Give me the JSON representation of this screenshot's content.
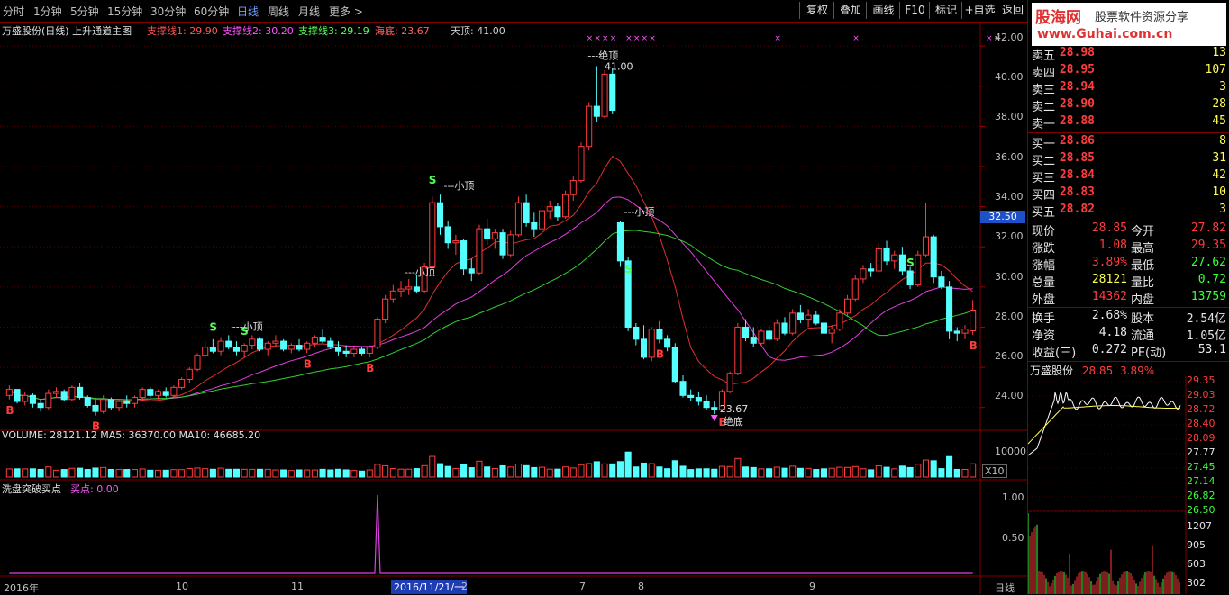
{
  "periods": [
    "分时",
    "1分钟",
    "5分钟",
    "15分钟",
    "30分钟",
    "60分钟",
    "日线",
    "周线",
    "月线",
    "更多 >"
  ],
  "active_period": "日线",
  "toolbar": [
    "复权",
    "叠加",
    "画线",
    "F10",
    "标记",
    "+自选",
    "返回"
  ],
  "logo": {
    "main": "股海网",
    "sub": "股票软件资源分享",
    "url": "www.Guhai.com.cn"
  },
  "main_title": "万盛股份(日线) 上升通道主图",
  "indicators": [
    {
      "label": "支撑线1: 29.90",
      "color": "#ff5555"
    },
    {
      "label": "支撑线2: 30.20",
      "color": "#ff55ff"
    },
    {
      "label": "支撑线3: 29.19",
      "color": "#55ff55"
    },
    {
      "label": "海底: 23.67",
      "color": "#ff6060"
    },
    {
      "label": "天顶: 41.00",
      "color": "#d0d0d0"
    }
  ],
  "price_axis": [
    "42.00",
    "40.00",
    "38.00",
    "36.00",
    "34.00",
    "32.00",
    "30.00",
    "28.00",
    "26.00",
    "24.00"
  ],
  "price_marker": "32.50",
  "volume_title": "VOLUME: 28121.12  MA5: 36370.00  MA10: 46685.20",
  "volume_axis": [
    "10000"
  ],
  "volume_unit": "X10",
  "sub_title": "洗盘突破买点",
  "sub_value": "买点: 0.00",
  "sub_axis": [
    "1.00",
    "0.50"
  ],
  "dates": [
    "2016年",
    "10",
    "11",
    "2016/11/21/一",
    "2",
    "7",
    "8",
    "9"
  ],
  "date_mode": "日线",
  "annotations": {
    "top": "---绝顶",
    "top_price": "41.00",
    "small_top": "---小顶",
    "bottom": "23.67",
    "bottom_label": "绝底",
    "S": "S",
    "B": "B"
  },
  "order_book": [
    {
      "label": "卖五",
      "price": "28.98",
      "vol": "13"
    },
    {
      "label": "卖四",
      "price": "28.95",
      "vol": "107"
    },
    {
      "label": "卖三",
      "price": "28.94",
      "vol": "3"
    },
    {
      "label": "卖二",
      "price": "28.90",
      "vol": "28"
    },
    {
      "label": "卖一",
      "price": "28.88",
      "vol": "45"
    },
    {
      "label": "买一",
      "price": "28.86",
      "vol": "8"
    },
    {
      "label": "买二",
      "price": "28.85",
      "vol": "31"
    },
    {
      "label": "买三",
      "price": "28.84",
      "vol": "42"
    },
    {
      "label": "买四",
      "price": "28.83",
      "vol": "10"
    },
    {
      "label": "买五",
      "price": "28.82",
      "vol": "3"
    }
  ],
  "quote": [
    {
      "k1": "现价",
      "v1": "28.85",
      "c1": "#ff3c3c",
      "k2": "今开",
      "v2": "27.82",
      "c2": "#ff3c3c"
    },
    {
      "k1": "涨跌",
      "v1": "1.08",
      "c1": "#ff3c3c",
      "k2": "最高",
      "v2": "29.35",
      "c2": "#ff3c3c"
    },
    {
      "k1": "涨幅",
      "v1": "3.89%",
      "c1": "#ff3c3c",
      "k2": "最低",
      "v2": "27.62",
      "c2": "#3cff3c"
    },
    {
      "k1": "总量",
      "v1": "28121",
      "c1": "#ffff54",
      "k2": "量比",
      "v2": "0.72",
      "c2": "#3cff3c"
    },
    {
      "k1": "外盘",
      "v1": "14362",
      "c1": "#ff3c3c",
      "k2": "内盘",
      "v2": "13759",
      "c2": "#3cff3c"
    },
    {
      "k1": "换手",
      "v1": "2.68%",
      "c1": "#e6e6e6",
      "k2": "股本",
      "v2": "2.54亿",
      "c2": "#e6e6e6"
    },
    {
      "k1": "净资",
      "v1": "4.18",
      "c1": "#e6e6e6",
      "k2": "流通",
      "v2": "1.05亿",
      "c2": "#e6e6e6"
    },
    {
      "k1": "收益(三)",
      "v1": "0.272",
      "c1": "#e6e6e6",
      "k2": "PE(动)",
      "v2": "53.1",
      "c2": "#e6e6e6"
    }
  ],
  "mini": {
    "name": "万盛股份",
    "price": "28.85",
    "pct": "3.89%",
    "price_axis": [
      "29.35",
      "29.03",
      "28.72",
      "28.40",
      "28.09",
      "27.77",
      "27.45",
      "27.14",
      "26.82",
      "26.50"
    ],
    "vol_axis": [
      "1207",
      "905",
      "603",
      "302"
    ]
  },
  "chart_data": {
    "type": "candlestick",
    "title": "万盛股份(日线) 上升通道主图",
    "ylim": [
      23,
      42.5
    ],
    "candles": [
      [
        24.6,
        25.1,
        24.4,
        24.9
      ],
      [
        24.9,
        24.9,
        24.2,
        24.3
      ],
      [
        24.3,
        24.8,
        24.1,
        24.6
      ],
      [
        24.6,
        24.7,
        24.0,
        24.2
      ],
      [
        24.2,
        24.4,
        23.8,
        24.0
      ],
      [
        24.0,
        24.9,
        23.9,
        24.7
      ],
      [
        24.7,
        25.0,
        24.5,
        24.8
      ],
      [
        24.8,
        24.9,
        24.3,
        24.4
      ],
      [
        24.4,
        25.1,
        24.3,
        25.0
      ],
      [
        25.0,
        25.2,
        24.4,
        24.5
      ],
      [
        24.5,
        24.6,
        24.0,
        24.1
      ],
      [
        24.1,
        24.4,
        23.6,
        23.8
      ],
      [
        23.8,
        24.6,
        23.7,
        24.4
      ],
      [
        24.4,
        24.5,
        23.9,
        24.0
      ],
      [
        24.0,
        24.4,
        23.8,
        24.3
      ],
      [
        24.3,
        24.6,
        24.0,
        24.2
      ],
      [
        24.2,
        24.6,
        24.0,
        24.5
      ],
      [
        24.5,
        25.0,
        24.3,
        24.9
      ],
      [
        24.9,
        25.0,
        24.5,
        24.6
      ],
      [
        24.6,
        24.9,
        24.4,
        24.8
      ],
      [
        24.8,
        25.0,
        24.5,
        24.6
      ],
      [
        24.6,
        25.1,
        24.5,
        25.0
      ],
      [
        25.0,
        25.5,
        24.9,
        25.4
      ],
      [
        25.4,
        26.0,
        25.2,
        25.9
      ],
      [
        25.9,
        26.7,
        25.8,
        26.6
      ],
      [
        26.6,
        27.3,
        26.5,
        27.0
      ],
      [
        27.0,
        27.4,
        26.7,
        26.8
      ],
      [
        26.8,
        27.5,
        26.6,
        27.3
      ],
      [
        27.3,
        27.6,
        26.9,
        27.0
      ],
      [
        27.0,
        27.3,
        26.6,
        26.8
      ],
      [
        26.8,
        27.2,
        26.5,
        27.1
      ],
      [
        27.1,
        27.6,
        26.9,
        27.4
      ],
      [
        27.4,
        27.5,
        26.8,
        26.9
      ],
      [
        26.9,
        27.3,
        26.6,
        27.2
      ],
      [
        27.2,
        27.6,
        27.0,
        27.3
      ],
      [
        27.3,
        27.4,
        26.8,
        26.9
      ],
      [
        26.9,
        27.2,
        26.7,
        27.1
      ],
      [
        27.1,
        27.4,
        26.8,
        26.9
      ],
      [
        26.9,
        27.3,
        26.7,
        27.2
      ],
      [
        27.2,
        27.6,
        27.0,
        27.5
      ],
      [
        27.5,
        27.9,
        27.2,
        27.3
      ],
      [
        27.3,
        27.5,
        26.9,
        27.0
      ],
      [
        27.0,
        27.3,
        26.6,
        26.8
      ],
      [
        26.8,
        27.1,
        26.5,
        26.7
      ],
      [
        26.7,
        27.0,
        26.5,
        26.9
      ],
      [
        26.9,
        27.0,
        26.6,
        26.7
      ],
      [
        26.7,
        27.1,
        26.5,
        27.0
      ],
      [
        27.0,
        28.5,
        26.9,
        28.4
      ],
      [
        28.4,
        29.6,
        28.2,
        29.4
      ],
      [
        29.4,
        30.1,
        29.2,
        29.8
      ],
      [
        29.8,
        30.3,
        29.5,
        29.9
      ],
      [
        29.9,
        30.4,
        29.6,
        30.0
      ],
      [
        30.0,
        30.6,
        29.7,
        29.8
      ],
      [
        29.8,
        31.2,
        29.7,
        31.0
      ],
      [
        31.0,
        34.5,
        30.9,
        34.2
      ],
      [
        34.2,
        34.6,
        32.6,
        33.0
      ],
      [
        33.0,
        33.3,
        31.9,
        32.2
      ],
      [
        32.2,
        32.6,
        31.6,
        32.3
      ],
      [
        32.3,
        32.4,
        30.6,
        30.9
      ],
      [
        30.9,
        31.4,
        30.3,
        30.7
      ],
      [
        30.7,
        33.1,
        30.6,
        32.9
      ],
      [
        32.9,
        33.4,
        32.1,
        32.4
      ],
      [
        32.4,
        32.9,
        31.9,
        32.7
      ],
      [
        32.7,
        32.9,
        31.4,
        31.6
      ],
      [
        31.6,
        32.8,
        31.5,
        32.6
      ],
      [
        32.6,
        34.5,
        32.5,
        34.2
      ],
      [
        34.2,
        34.6,
        33.0,
        33.2
      ],
      [
        33.2,
        33.7,
        32.5,
        32.9
      ],
      [
        32.9,
        34.0,
        32.7,
        33.8
      ],
      [
        33.8,
        34.3,
        33.4,
        34.0
      ],
      [
        34.0,
        34.2,
        33.3,
        33.5
      ],
      [
        33.5,
        34.8,
        33.4,
        34.6
      ],
      [
        34.6,
        35.5,
        34.3,
        35.3
      ],
      [
        35.3,
        37.2,
        35.2,
        37.0
      ],
      [
        37.0,
        39.2,
        36.8,
        39.0
      ],
      [
        39.0,
        41.0,
        38.2,
        38.5
      ],
      [
        38.5,
        40.8,
        38.4,
        40.6
      ],
      [
        40.6,
        40.9,
        38.6,
        38.8
      ],
      [
        33.2,
        33.3,
        31.0,
        31.3
      ],
      [
        31.3,
        31.5,
        27.8,
        28.0
      ],
      [
        28.0,
        28.2,
        27.1,
        27.4
      ],
      [
        27.4,
        28.1,
        26.4,
        26.5
      ],
      [
        26.5,
        28.0,
        26.3,
        27.9
      ],
      [
        27.9,
        28.3,
        27.2,
        27.4
      ],
      [
        27.4,
        27.6,
        26.8,
        27.0
      ],
      [
        27.0,
        27.2,
        25.2,
        25.3
      ],
      [
        25.3,
        25.6,
        24.5,
        24.6
      ],
      [
        24.6,
        24.9,
        24.3,
        24.5
      ],
      [
        24.5,
        24.8,
        24.1,
        24.3
      ],
      [
        24.3,
        24.6,
        23.9,
        24.0
      ],
      [
        24.0,
        24.3,
        23.67,
        23.9
      ],
      [
        23.9,
        24.9,
        23.8,
        24.8
      ],
      [
        24.8,
        25.8,
        24.7,
        25.7
      ],
      [
        25.7,
        28.2,
        25.6,
        28.0
      ],
      [
        28.0,
        28.4,
        27.3,
        27.5
      ],
      [
        27.5,
        28.0,
        27.0,
        27.2
      ],
      [
        27.2,
        27.9,
        27.1,
        27.8
      ],
      [
        27.8,
        28.1,
        27.3,
        27.4
      ],
      [
        27.4,
        28.4,
        27.3,
        28.2
      ],
      [
        28.2,
        28.5,
        27.6,
        27.7
      ],
      [
        27.7,
        28.9,
        27.6,
        28.7
      ],
      [
        28.7,
        29.1,
        28.2,
        28.4
      ],
      [
        28.4,
        28.9,
        28.0,
        28.6
      ],
      [
        28.6,
        28.8,
        28.1,
        28.2
      ],
      [
        28.2,
        28.4,
        27.6,
        27.7
      ],
      [
        27.7,
        28.1,
        27.2,
        27.9
      ],
      [
        27.9,
        28.9,
        27.8,
        28.7
      ],
      [
        28.7,
        29.6,
        28.5,
        29.4
      ],
      [
        29.4,
        30.6,
        29.3,
        30.4
      ],
      [
        30.4,
        31.1,
        30.2,
        30.9
      ],
      [
        30.9,
        31.2,
        30.5,
        30.8
      ],
      [
        30.8,
        32.2,
        30.7,
        31.9
      ],
      [
        31.9,
        32.3,
        31.1,
        31.3
      ],
      [
        31.3,
        31.8,
        30.9,
        31.6
      ],
      [
        31.6,
        32.0,
        30.6,
        30.8
      ],
      [
        30.8,
        31.0,
        29.9,
        30.1
      ],
      [
        30.1,
        31.8,
        30.0,
        31.6
      ],
      [
        31.6,
        34.2,
        31.5,
        32.5
      ],
      [
        32.5,
        32.6,
        30.2,
        30.5
      ],
      [
        30.5,
        30.8,
        29.9,
        30.0
      ],
      [
        30.0,
        30.3,
        27.4,
        27.8
      ],
      [
        27.8,
        28.0,
        27.3,
        27.7
      ],
      [
        27.7,
        28.1,
        27.4,
        27.9
      ],
      [
        27.82,
        29.35,
        27.62,
        28.85
      ]
    ]
  }
}
